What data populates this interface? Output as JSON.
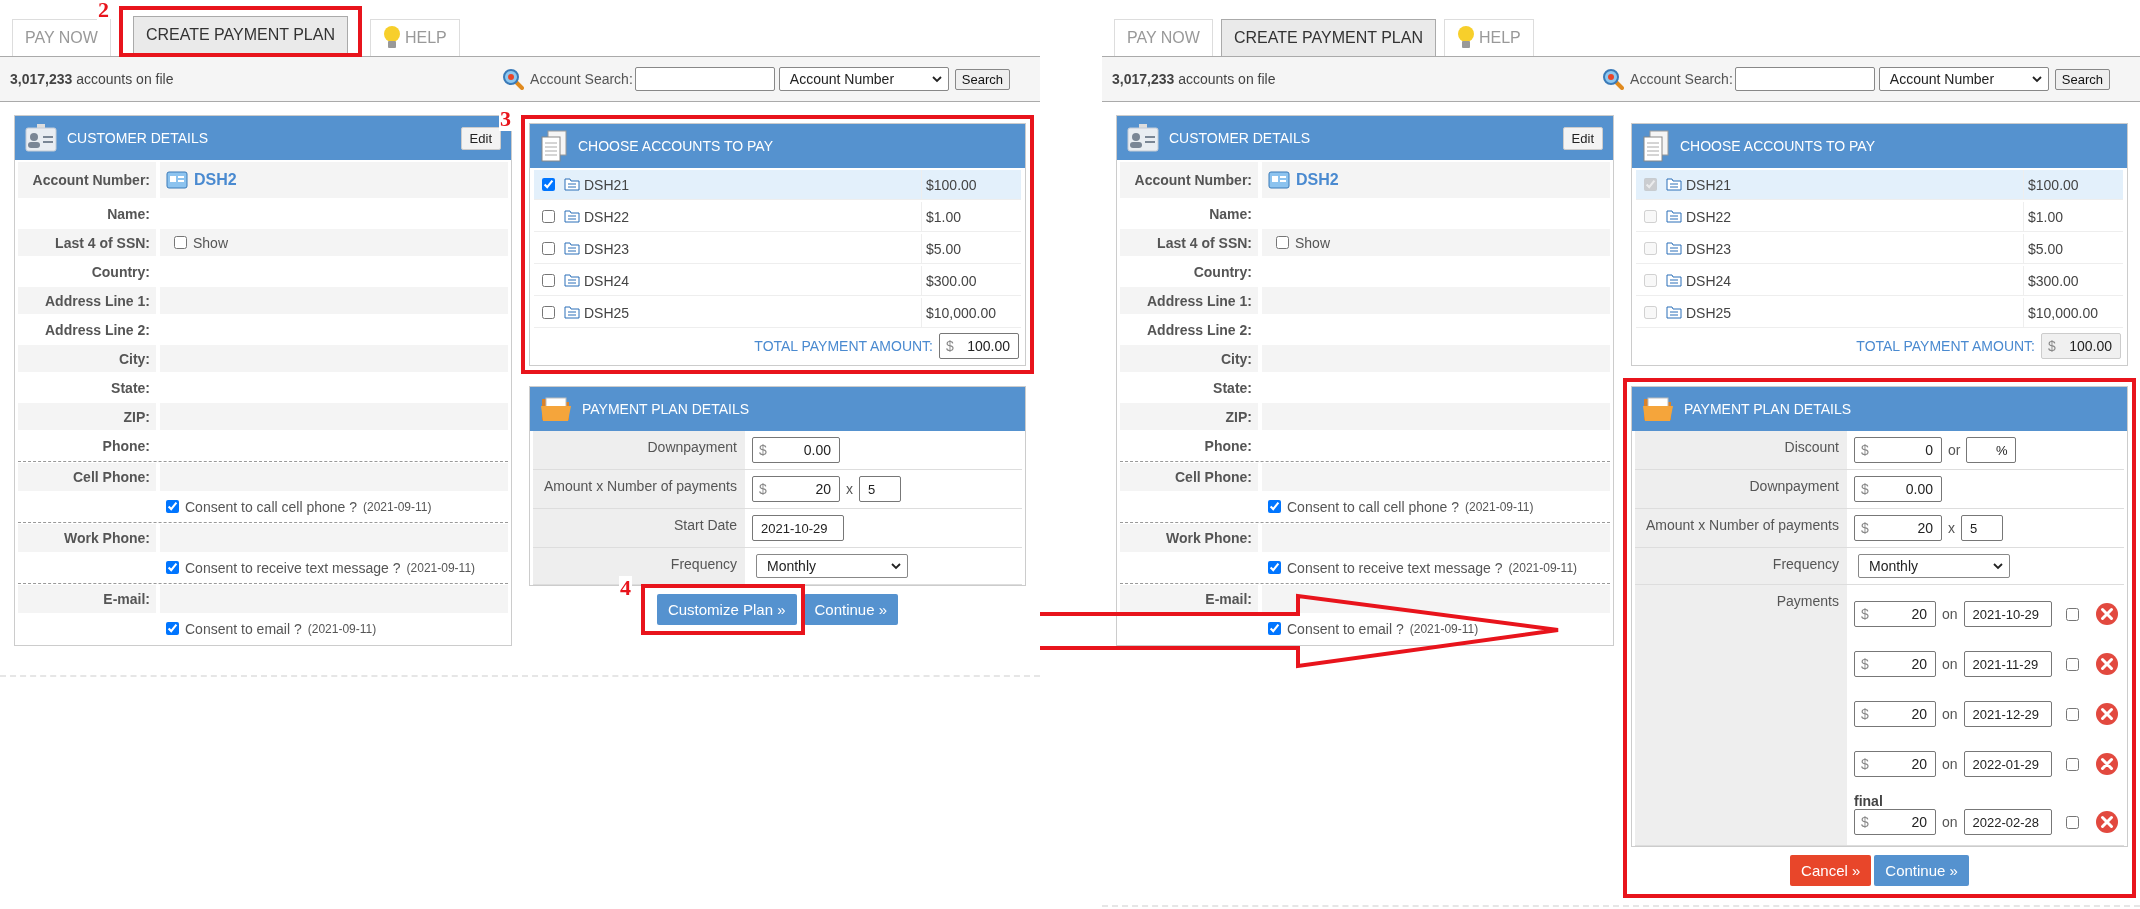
{
  "screens": [
    {
      "tabs": [
        {
          "label": "PAY NOW",
          "selected": false,
          "kind": "plain"
        },
        {
          "label": "CREATE PAYMENT PLAN",
          "selected": true,
          "kind": "plain",
          "marker": "2"
        },
        {
          "label": "HELP",
          "selected": false,
          "kind": "help"
        }
      ],
      "toolbar": {
        "count": "3,017,233",
        "suffix": "accounts on file",
        "search_label": "Account Search:",
        "search_by": "Account Number",
        "search_button": "Search"
      },
      "customer_details": {
        "title": "CUSTOMER DETAILS",
        "edit": "Edit",
        "rows": [
          {
            "kind": "account",
            "label": "Account Number:",
            "value": "DSH2"
          },
          {
            "kind": "field",
            "label": "Name:",
            "divided": false
          },
          {
            "kind": "toggle",
            "label": "Last 4 of SSN:",
            "option": "Show",
            "checked": false
          },
          {
            "kind": "field",
            "label": "Country:",
            "divided": false
          },
          {
            "kind": "field",
            "label": "Address Line 1:",
            "divided": false
          },
          {
            "kind": "field",
            "label": "Address Line 2:",
            "divided": false
          },
          {
            "kind": "field",
            "label": "City:",
            "divided": false
          },
          {
            "kind": "field",
            "label": "State:",
            "divided": false
          },
          {
            "kind": "field",
            "label": "ZIP:",
            "divided": false
          },
          {
            "kind": "field",
            "label": "Phone:",
            "divided": false
          },
          {
            "kind": "field",
            "label": "Cell Phone:",
            "divided": true
          },
          {
            "kind": "consent",
            "text": "Consent to call cell phone ?",
            "date": "(2021-09-11)",
            "checked": true
          },
          {
            "kind": "field",
            "label": "Work Phone:",
            "divided": true
          },
          {
            "kind": "consent",
            "text": "Consent to receive text message ?",
            "date": "(2021-09-11)",
            "checked": true
          },
          {
            "kind": "field",
            "label": "E-mail:",
            "divided": true
          },
          {
            "kind": "consent",
            "text": "Consent to email ?",
            "date": "(2021-09-11)",
            "checked": true
          }
        ]
      },
      "choose_accounts": {
        "title": "CHOOSE ACCOUNTS TO PAY",
        "highlighted": true,
        "marker": "3",
        "accounts": [
          {
            "name": "DSH21",
            "amount": "$100.00",
            "checked": true,
            "disabled": false,
            "selected": true
          },
          {
            "name": "DSH22",
            "amount": "$1.00",
            "checked": false,
            "disabled": false,
            "selected": false
          },
          {
            "name": "DSH23",
            "amount": "$5.00",
            "checked": false,
            "disabled": false,
            "selected": false
          },
          {
            "name": "DSH24",
            "amount": "$300.00",
            "checked": false,
            "disabled": false,
            "selected": false
          },
          {
            "name": "DSH25",
            "amount": "$10,000.00",
            "checked": false,
            "disabled": false,
            "selected": false
          }
        ],
        "total_label": "TOTAL PAYMENT AMOUNT:",
        "total": {
          "currency": "$",
          "value": "100.00",
          "disabled": false
        }
      },
      "plan": {
        "title": "PAYMENT PLAN DETAILS",
        "highlighted": false,
        "rows": [
          {
            "kind": "money",
            "label": "Downpayment",
            "currency": "$",
            "value": "0.00"
          },
          {
            "kind": "multiply",
            "label": "Amount x Number of payments",
            "currency": "$",
            "value": "20",
            "times": "x",
            "count": "5"
          },
          {
            "kind": "date",
            "label": "Start Date",
            "value": "2021-10-29"
          },
          {
            "kind": "select",
            "label": "Frequency",
            "value": "Monthly"
          }
        ],
        "buttons": [
          {
            "label": "Customize Plan »",
            "kind": "primary",
            "marker": "4"
          },
          {
            "label": "Continue »",
            "kind": "primary"
          }
        ]
      }
    },
    {
      "tabs": [
        {
          "label": "PAY NOW",
          "selected": false,
          "kind": "plain"
        },
        {
          "label": "CREATE PAYMENT PLAN",
          "selected": true,
          "kind": "plain"
        },
        {
          "label": "HELP",
          "selected": false,
          "kind": "help"
        }
      ],
      "toolbar": {
        "count": "3,017,233",
        "suffix": "accounts on file",
        "search_label": "Account Search:",
        "search_by": "Account Number",
        "search_button": "Search"
      },
      "customer_details": {
        "title": "CUSTOMER DETAILS",
        "edit": "Edit",
        "rows": [
          {
            "kind": "account",
            "label": "Account Number:",
            "value": "DSH2"
          },
          {
            "kind": "field",
            "label": "Name:",
            "divided": false
          },
          {
            "kind": "toggle",
            "label": "Last 4 of SSN:",
            "option": "Show",
            "checked": false
          },
          {
            "kind": "field",
            "label": "Country:",
            "divided": false
          },
          {
            "kind": "field",
            "label": "Address Line 1:",
            "divided": false
          },
          {
            "kind": "field",
            "label": "Address Line 2:",
            "divided": false
          },
          {
            "kind": "field",
            "label": "City:",
            "divided": false
          },
          {
            "kind": "field",
            "label": "State:",
            "divided": false
          },
          {
            "kind": "field",
            "label": "ZIP:",
            "divided": false
          },
          {
            "kind": "field",
            "label": "Phone:",
            "divided": false
          },
          {
            "kind": "field",
            "label": "Cell Phone:",
            "divided": true
          },
          {
            "kind": "consent",
            "text": "Consent to call cell phone ?",
            "date": "(2021-09-11)",
            "checked": true
          },
          {
            "kind": "field",
            "label": "Work Phone:",
            "divided": true
          },
          {
            "kind": "consent",
            "text": "Consent to receive text message ?",
            "date": "(2021-09-11)",
            "checked": true
          },
          {
            "kind": "field",
            "label": "E-mail:",
            "divided": true
          },
          {
            "kind": "consent",
            "text": "Consent to email ?",
            "date": "(2021-09-11)",
            "checked": true
          }
        ]
      },
      "choose_accounts": {
        "title": "CHOOSE ACCOUNTS TO PAY",
        "highlighted": false,
        "accounts": [
          {
            "name": "DSH21",
            "amount": "$100.00",
            "checked": true,
            "disabled": true,
            "selected": true
          },
          {
            "name": "DSH22",
            "amount": "$1.00",
            "checked": false,
            "disabled": true,
            "selected": false
          },
          {
            "name": "DSH23",
            "amount": "$5.00",
            "checked": false,
            "disabled": true,
            "selected": false
          },
          {
            "name": "DSH24",
            "amount": "$300.00",
            "checked": false,
            "disabled": true,
            "selected": false
          },
          {
            "name": "DSH25",
            "amount": "$10,000.00",
            "checked": false,
            "disabled": true,
            "selected": false
          }
        ],
        "total_label": "TOTAL PAYMENT AMOUNT:",
        "total": {
          "currency": "$",
          "value": "100.00",
          "disabled": true
        }
      },
      "plan": {
        "title": "PAYMENT PLAN DETAILS",
        "highlighted": true,
        "rows": [
          {
            "kind": "discount",
            "label": "Discount",
            "currency": "$",
            "value": "0",
            "or": "or",
            "percent": "%"
          },
          {
            "kind": "money",
            "label": "Downpayment",
            "currency": "$",
            "value": "0.00"
          },
          {
            "kind": "multiply",
            "label": "Amount x Number of payments",
            "currency": "$",
            "value": "20",
            "times": "x",
            "count": "5"
          },
          {
            "kind": "select",
            "label": "Frequency",
            "value": "Monthly"
          },
          {
            "kind": "payments",
            "label": "Payments",
            "payments": [
              {
                "currency": "$",
                "value": "20",
                "on": "on",
                "date": "2021-10-29",
                "checked": false
              },
              {
                "currency": "$",
                "value": "20",
                "on": "on",
                "date": "2021-11-29",
                "checked": false
              },
              {
                "currency": "$",
                "value": "20",
                "on": "on",
                "date": "2021-12-29",
                "checked": false
              },
              {
                "currency": "$",
                "value": "20",
                "on": "on",
                "date": "2022-01-29",
                "checked": false
              },
              {
                "note": "final",
                "currency": "$",
                "value": "20",
                "on": "on",
                "date": "2022-02-28",
                "checked": false
              }
            ]
          }
        ],
        "buttons": [
          {
            "label": "Cancel »",
            "kind": "danger"
          },
          {
            "label": "Continue »",
            "kind": "primary"
          }
        ]
      }
    }
  ]
}
